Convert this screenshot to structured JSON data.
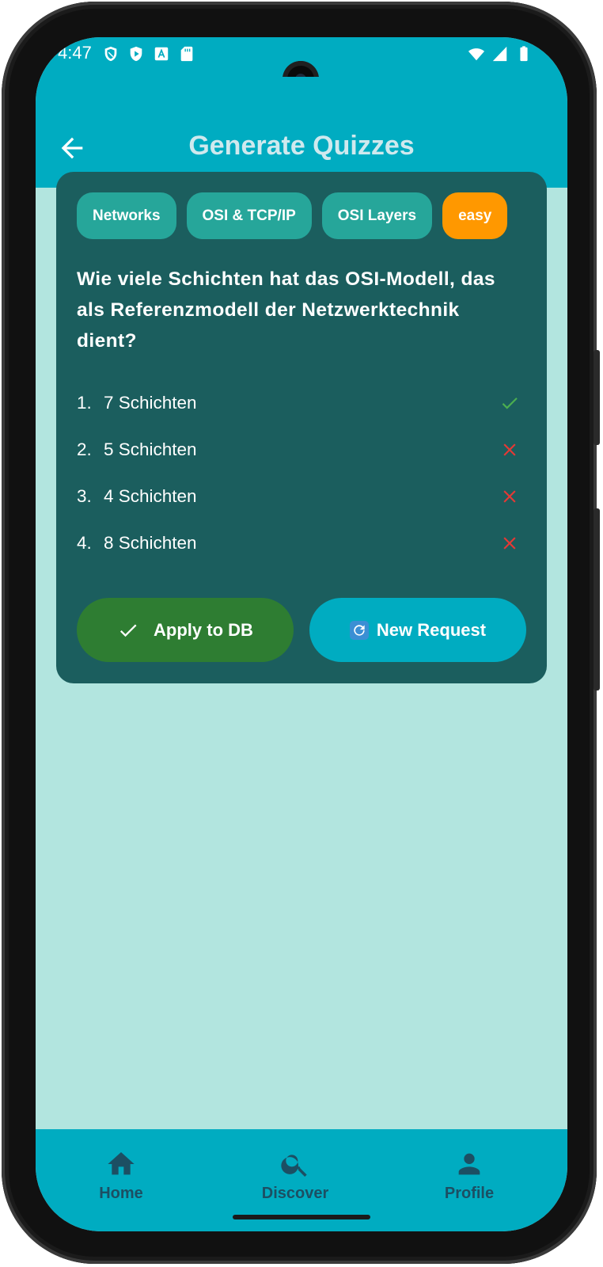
{
  "status_bar": {
    "time": "4:47",
    "left_icons": [
      "shield-icon",
      "play-protect-icon",
      "keyboard-a-icon",
      "sd-card-icon"
    ],
    "right_icons": [
      "wifi-icon",
      "signal-icon",
      "battery-icon"
    ]
  },
  "app_bar": {
    "title": "Generate Quizzes",
    "back_icon": "arrow-back-icon"
  },
  "quiz": {
    "tags": [
      {
        "label": "Networks"
      },
      {
        "label": "OSI & TCP/IP"
      },
      {
        "label": "OSI Layers"
      }
    ],
    "difficulty": "easy",
    "question": "Wie viele Schichten hat das OSI-Modell, das als Referenzmodell der Netzwerktechnik dient?",
    "answers": [
      {
        "number": "1.",
        "text": "7 Schichten",
        "correct": true
      },
      {
        "number": "2.",
        "text": "5 Schichten",
        "correct": false
      },
      {
        "number": "3.",
        "text": "4 Schichten",
        "correct": false
      },
      {
        "number": "4.",
        "text": "8 Schichten",
        "correct": false
      }
    ]
  },
  "actions": {
    "apply_label": "Apply to DB",
    "apply_icon": "check-icon",
    "new_request_label": "New Request",
    "new_request_icon": "refresh-emoji-icon"
  },
  "bottom_nav": {
    "items": [
      {
        "label": "Home",
        "icon": "home-icon"
      },
      {
        "label": "Discover",
        "icon": "search-icon"
      },
      {
        "label": "Profile",
        "icon": "person-icon"
      }
    ]
  },
  "colors": {
    "primary": "#00acc1",
    "background": "#b2e5df",
    "card": "#1b5e5e",
    "tag": "#26a69a",
    "difficulty": "#ff9800",
    "apply_button": "#2e7d32",
    "correct": "#4caf50",
    "wrong": "#e53935"
  }
}
